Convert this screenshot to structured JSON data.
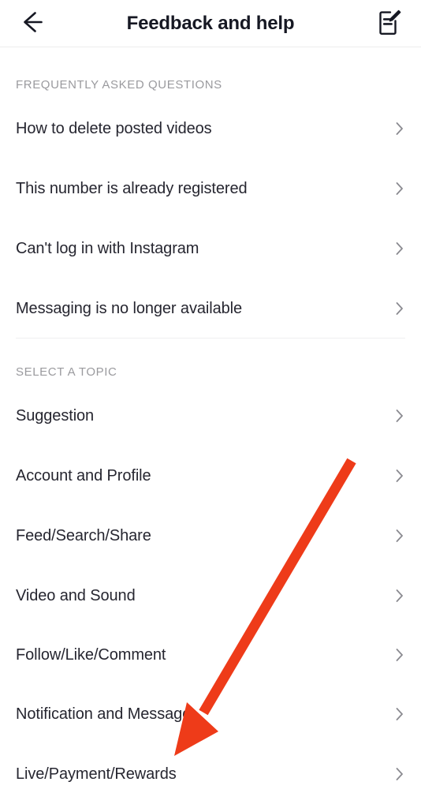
{
  "app": {
    "background_color": "#ffffff",
    "text_color": "#262630",
    "muted_color": "#9a9a9e",
    "accent_color": "#ee3b19"
  },
  "header": {
    "title": "Feedback and help",
    "back_icon": "arrow-left-icon",
    "edit_icon": "compose-form-icon"
  },
  "sections": [
    {
      "label": "FREQUENTLY ASKED QUESTIONS",
      "items": [
        {
          "label": "How to delete posted videos",
          "chevron": "chevron-right-icon"
        },
        {
          "label": "This number is already registered",
          "chevron": "chevron-right-icon"
        },
        {
          "label": "Can't log in with Instagram",
          "chevron": "chevron-right-icon"
        },
        {
          "label": "Messaging is no longer available",
          "chevron": "chevron-right-icon"
        }
      ]
    },
    {
      "label": "SELECT A TOPIC",
      "items": [
        {
          "label": "Suggestion",
          "chevron": "chevron-right-icon"
        },
        {
          "label": "Account and Profile",
          "chevron": "chevron-right-icon"
        },
        {
          "label": "Feed/Search/Share",
          "chevron": "chevron-right-icon"
        },
        {
          "label": "Video and Sound",
          "chevron": "chevron-right-icon"
        },
        {
          "label": "Follow/Like/Comment",
          "chevron": "chevron-right-icon"
        },
        {
          "label": "Notification and Message",
          "chevron": "chevron-right-icon"
        },
        {
          "label": "Live/Payment/Rewards",
          "chevron": "chevron-right-icon"
        }
      ]
    }
  ],
  "annotation": {
    "type": "arrow",
    "color": "#ee3b19",
    "points_to": "Live/Payment/Rewards"
  }
}
